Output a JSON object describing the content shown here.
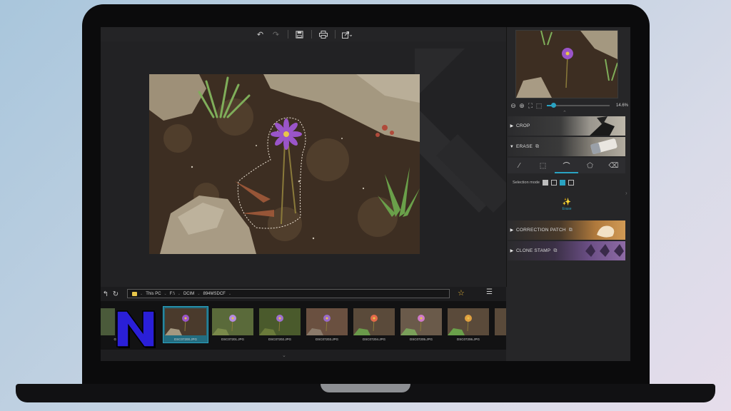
{
  "toolbar": {
    "undo_icon": "undo-icon",
    "redo_icon": "redo-icon",
    "save_icon": "save-icon",
    "print_icon": "print-icon",
    "share_icon": "share-icon"
  },
  "navigator": {
    "zoom_percent": "14.6%",
    "zoom_fraction": 0.1
  },
  "tool_sections": {
    "crop": "CROP",
    "erase": "ERASE",
    "correction_patch": "CORRECTION PATCH",
    "clone_stamp": "CLONE STAMP"
  },
  "erase_panel": {
    "selection_mode_label": "Selection mode",
    "erase_button_label": "Erase"
  },
  "path_bar": {
    "crumbs": [
      "This PC",
      "F:\\",
      "DCIM",
      "894MSDCF"
    ]
  },
  "filmstrip": {
    "items": [
      {
        "name": "DSC07200.JPG",
        "selected": true
      },
      {
        "name": "DSC07201.JPG",
        "selected": false
      },
      {
        "name": "DSC07202.JPG",
        "selected": false
      },
      {
        "name": "DSC07203.JPG",
        "selected": false
      },
      {
        "name": "DSC07204.JPG",
        "selected": false
      },
      {
        "name": "DSC07205.JPG",
        "selected": false
      },
      {
        "name": "DSC07206.JPG",
        "selected": false
      }
    ],
    "partial_first_name": "G"
  },
  "colors": {
    "accent": "#2aa3c2",
    "star": "#e8b73a",
    "logo_fill": "#2a1fd8"
  }
}
